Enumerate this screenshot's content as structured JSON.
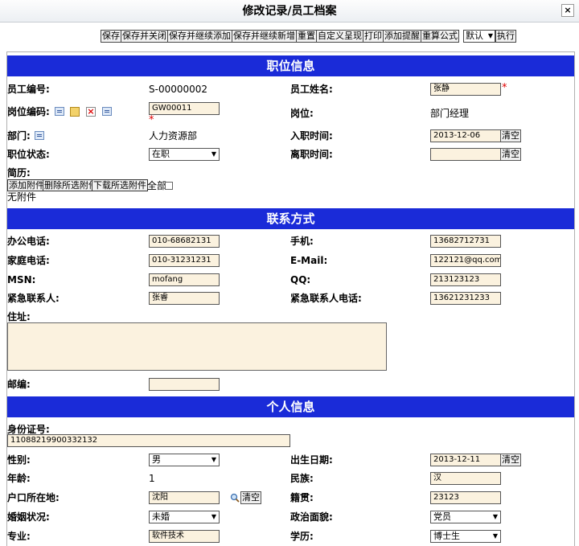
{
  "window": {
    "title": "修改记录/员工档案",
    "close_glyph": "×"
  },
  "toolbar": {
    "buttons": [
      "保存",
      "保存并关闭",
      "保存并继续添加",
      "保存并继续新增",
      "重置",
      "自定义呈现",
      "打印",
      "添加提醒",
      "重算公式"
    ],
    "view_select": "默认",
    "exec": "执行"
  },
  "sections": {
    "position": "职位信息",
    "contact": "联系方式",
    "personal": "个人信息"
  },
  "position": {
    "emp_no_label": "员工编号:",
    "emp_no": "S-00000002",
    "name_label": "员工姓名:",
    "name": "张静",
    "post_code_label": "岗位编码:",
    "post_code": "GW00011",
    "post_label": "岗位:",
    "post": "部门经理",
    "dept_label": "部门:",
    "dept": "人力资源部",
    "join_label": "入职时间:",
    "join_date": "2013-12-06",
    "status_label": "职位状态:",
    "status": "在职",
    "leave_label": "离职时间:",
    "leave_date": "",
    "resume_label": "简历:",
    "att_add": "添加附件",
    "att_del": "删除所选附件",
    "att_download": "下载所选附件",
    "att_all": "全部",
    "no_att": "无附件"
  },
  "contact": {
    "office_label": "办公电话:",
    "office": "010-68682131",
    "mobile_label": "手机:",
    "mobile": "13682712731",
    "home_label": "家庭电话:",
    "home": "010-31231231",
    "email_label": "E-Mail:",
    "email": "122121@qq.com",
    "msn_label": "MSN:",
    "msn": "mofang",
    "qq_label": "QQ:",
    "qq": "213123123",
    "emerg_label": "紧急联系人:",
    "emerg": "张睿",
    "emerg_phone_label": "紧急联系人电话:",
    "emerg_phone": "13621231233",
    "address_label": "住址:",
    "zip_label": "邮编:",
    "zip": ""
  },
  "personal": {
    "id_label": "身份证号:",
    "id": "11088219900332132",
    "gender_label": "性别:",
    "gender": "男",
    "birth_label": "出生日期:",
    "birth": "2013-12-11",
    "age_label": "年龄:",
    "age": "1",
    "ethnic_label": "民族:",
    "ethnic": "汉",
    "hukou_label": "户口所在地:",
    "hukou": "沈阳",
    "native_label": "籍贯:",
    "native": "23123",
    "marital_label": "婚姻状况:",
    "marital": "未婚",
    "political_label": "政治面貌:",
    "political": "党员",
    "major_label": "专业:",
    "major": "软件技术",
    "edu_label": "学历:",
    "edu": "博士生"
  },
  "common": {
    "clear": "清空",
    "required_mark": "*",
    "caret": "▼"
  },
  "colors": {
    "section_bg": "#1a2bd8",
    "input_bg": "#fbf2df"
  }
}
